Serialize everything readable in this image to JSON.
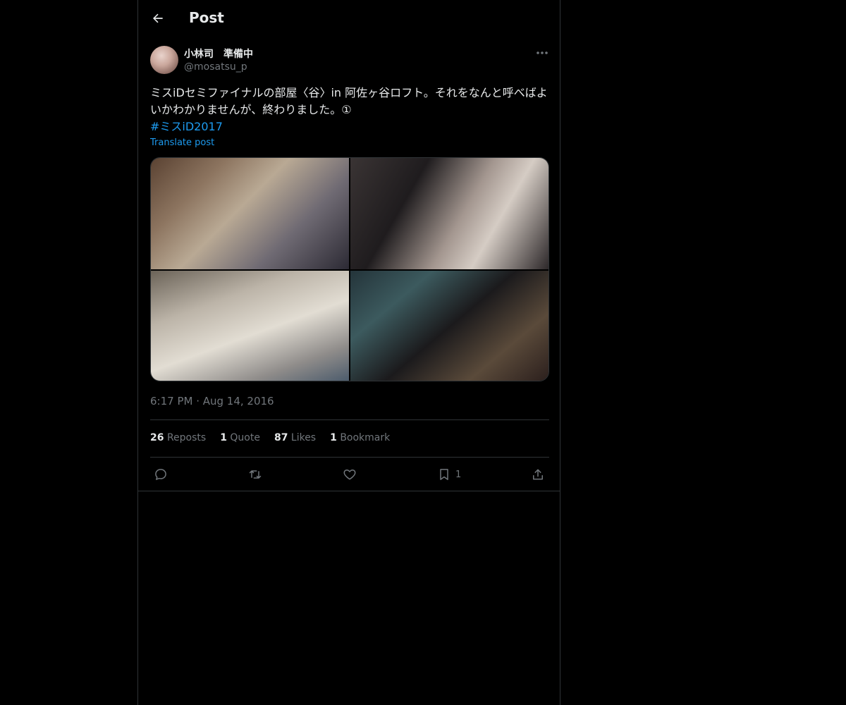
{
  "header": {
    "title": "Post",
    "back_icon": "arrow-left-icon"
  },
  "post": {
    "author": {
      "display_name": "小林司　準備中",
      "handle": "@mosatsu_p"
    },
    "text": "ミスiDセミファイナルの部屋〈谷〉in 阿佐ヶ谷ロフト。それをなんと呼べばよいかわかりませんが、終わりました。①",
    "hashtag": "#ミスiD2017",
    "translate_label": "Translate post",
    "timestamp": "6:17 PM · Aug 14, 2016",
    "stats": {
      "reposts_count": "26",
      "reposts_label": "Reposts",
      "quotes_count": "1",
      "quotes_label": "Quote",
      "likes_count": "87",
      "likes_label": "Likes",
      "bookmarks_count": "1",
      "bookmarks_label": "Bookmark"
    },
    "actions": {
      "bookmark_count": "1"
    }
  },
  "colors": {
    "background": "#000000",
    "text": "#e7e9ea",
    "muted": "#71767b",
    "link": "#1d9bf0",
    "border": "#2f3336"
  }
}
